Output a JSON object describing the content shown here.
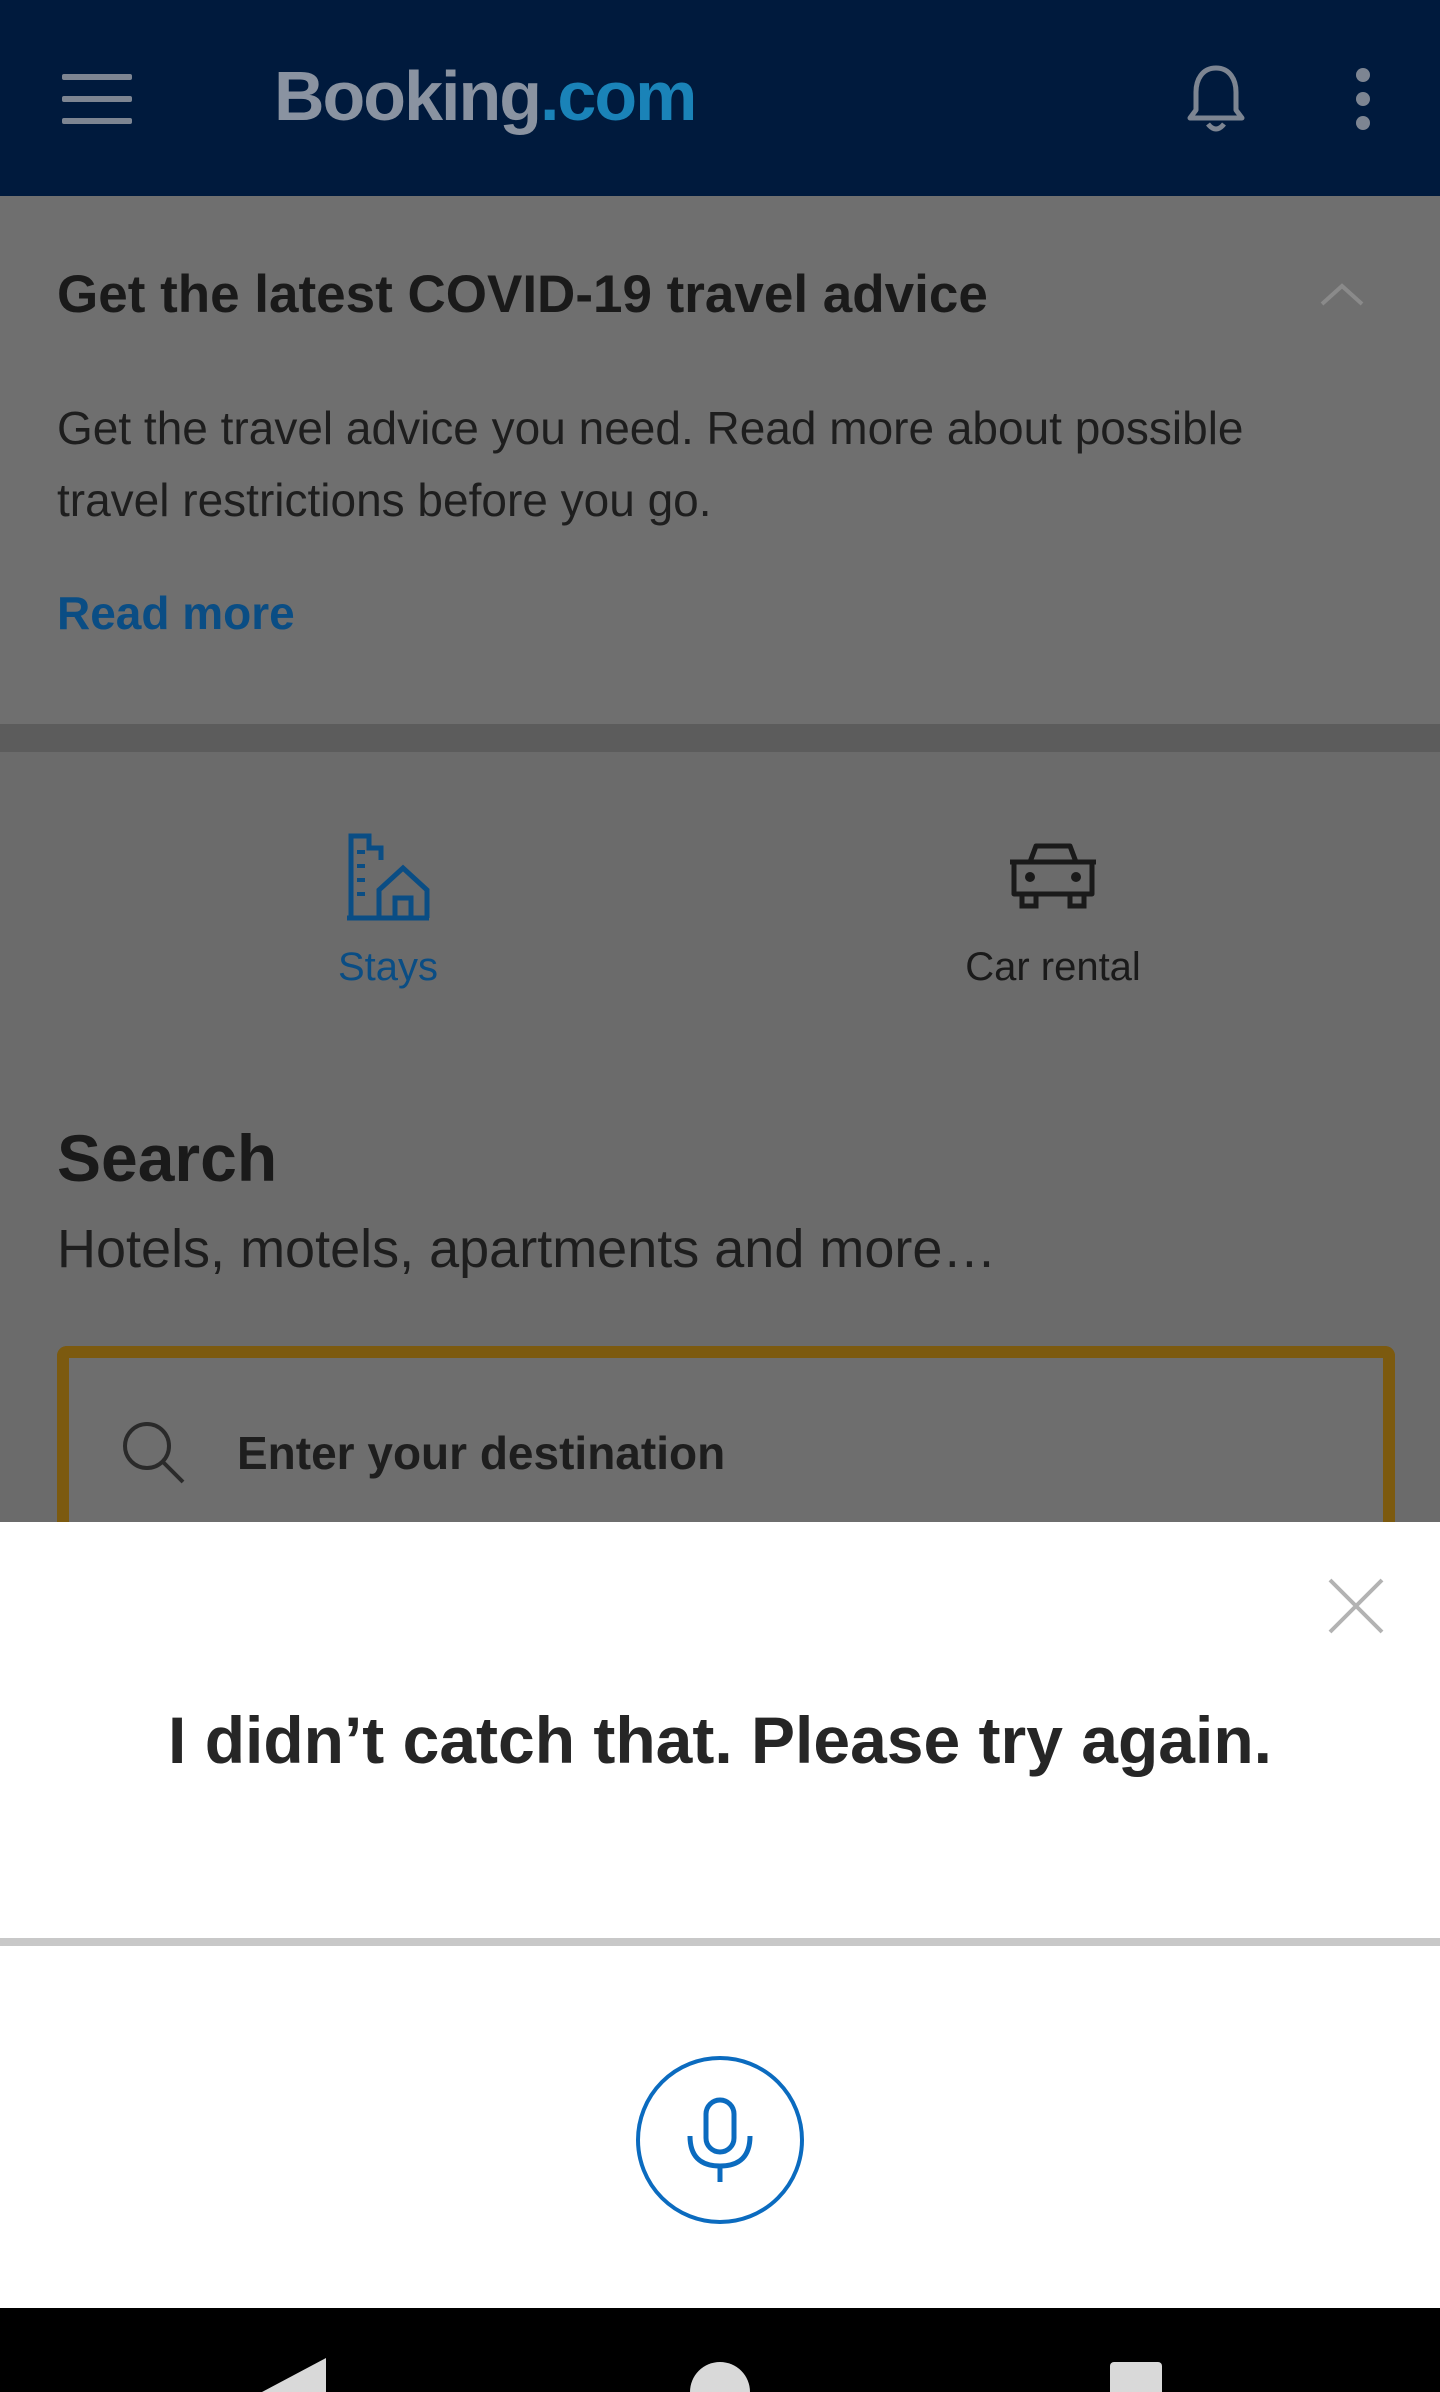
{
  "header": {
    "menu_icon": "hamburger-menu-icon",
    "logo_part1": "Booking",
    "logo_part2": ".com",
    "notifications_icon": "bell-icon",
    "overflow_icon": "more-vert-icon",
    "background_color": "#001a3d"
  },
  "covid_banner": {
    "title": "Get the latest COVID-19 travel advice",
    "body": "Get the travel advice you need. Read more about possible travel restrictions before you go.",
    "link": "Read more",
    "collapse_icon": "chevron-up-icon"
  },
  "product_tabs": [
    {
      "label": "Stays",
      "icon": "building-house-icon",
      "selected": true
    },
    {
      "label": "Car rental",
      "icon": "car-icon",
      "selected": false
    }
  ],
  "search": {
    "heading": "Search",
    "subheading": "Hotels, motels, apartments and more…",
    "destination_placeholder": "Enter your destination",
    "highlight_color": "#febb02"
  },
  "voice_sheet": {
    "message": "I didn’t catch that. Please try again.",
    "close_icon": "close-icon",
    "mic_icon": "microphone-icon",
    "accent_color": "#0b6bbf"
  },
  "system_nav": {
    "back_icon": "back-triangle-icon",
    "home_icon": "home-circle-icon",
    "recents_icon": "recents-square-icon"
  }
}
